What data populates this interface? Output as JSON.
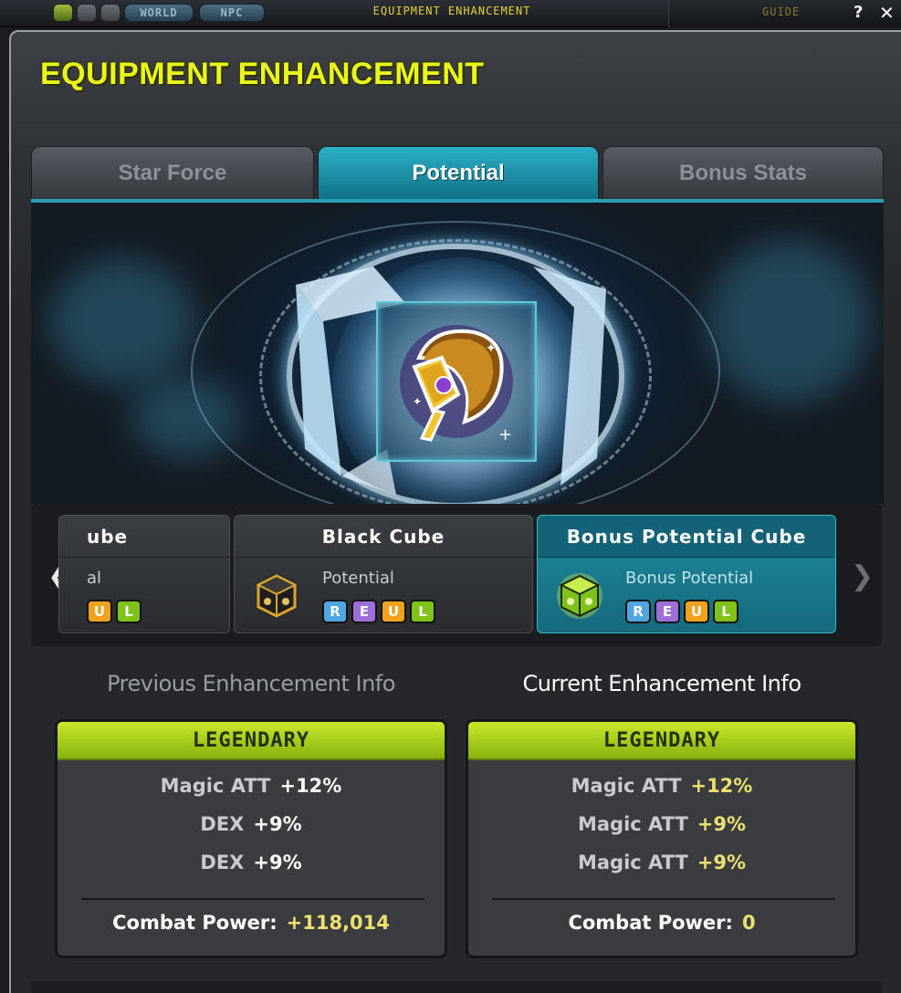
{
  "hud": {
    "world_label": "WORLD",
    "npc_label": "NPC",
    "title": "EQUIPMENT ENHANCEMENT",
    "guide_label": "GUIDE",
    "help_label": "?",
    "close_label": "✕"
  },
  "window": {
    "title": "EQUIPMENT ENHANCEMENT"
  },
  "tabs": [
    {
      "label": "Star Force",
      "active": false
    },
    {
      "label": "Potential",
      "active": true
    },
    {
      "label": "Bonus Stats",
      "active": false
    }
  ],
  "item": {
    "icon": "golden-arm-guard-icon"
  },
  "carousel": {
    "prev_arrow": "❮",
    "next_arrow": "❯",
    "cubes": [
      {
        "name": "ube",
        "type": "al",
        "grades": [
          "U",
          "L"
        ],
        "icon": "cube-icon"
      },
      {
        "name": "Black Cube",
        "type": "Potential",
        "grades": [
          "R",
          "E",
          "U",
          "L"
        ],
        "icon": "black-cube-icon"
      },
      {
        "name": "Bonus Potential Cube",
        "type": "Bonus Potential",
        "grades": [
          "R",
          "E",
          "U",
          "L"
        ],
        "icon": "bonus-potential-cube-icon",
        "selected": true
      }
    ]
  },
  "previous": {
    "heading": "Previous Enhancement Info",
    "rank": "LEGENDARY",
    "lines": [
      {
        "stat": "Magic ATT",
        "value": "+12%"
      },
      {
        "stat": "DEX",
        "value": "+9%"
      },
      {
        "stat": "DEX",
        "value": "+9%"
      }
    ],
    "combat_label": "Combat Power:",
    "combat_value": "+118,014"
  },
  "current": {
    "heading": "Current Enhancement Info",
    "rank": "LEGENDARY",
    "lines": [
      {
        "stat": "Magic ATT",
        "value": "+12%"
      },
      {
        "stat": "Magic ATT",
        "value": "+9%"
      },
      {
        "stat": "Magic ATT",
        "value": "+9%"
      }
    ],
    "combat_label": "Combat Power:",
    "combat_value": "0"
  },
  "colors": {
    "title_yellow": "#e9f51d",
    "tab_active": "#1d97ae",
    "legendary_green": "#a6cf1d",
    "highlight_yellow": "#ece06e"
  }
}
